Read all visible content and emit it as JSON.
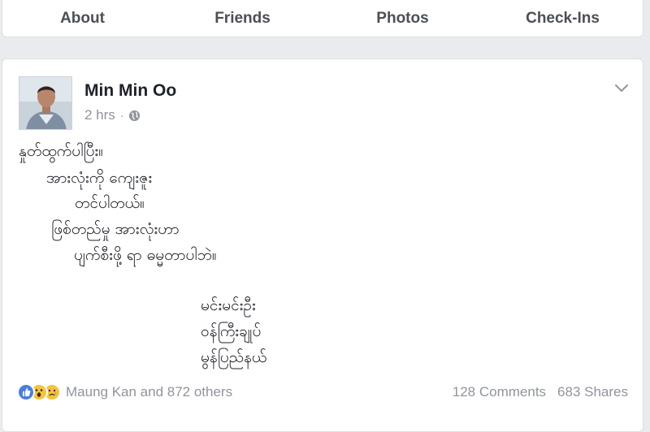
{
  "tabs": [
    {
      "label": "About"
    },
    {
      "label": "Friends"
    },
    {
      "label": "Photos"
    },
    {
      "label": "Check-Ins"
    }
  ],
  "post": {
    "author": "Min Min Oo",
    "time": "2 hrs",
    "separator": "·",
    "privacy_icon": "globe-icon",
    "menu_icon": "chevron-down-icon",
    "lines": [
      "နှုတ်ထွက်ပါပြီး။",
      "အားလုံးကို ကျေးဇူး",
      "တင်ပါတယ်။",
      "ဖြစ်တည်မှု အားလုံးဟာ",
      "ပျက်စီးဖို့ ရာ ဓမ္မတာပါဘဲ။",
      "မင်းမင်းဦး",
      "ဝန်ကြီးချုပ်",
      "မွန်ပြည်နယ်"
    ],
    "reactions": {
      "icons": [
        "like-icon",
        "wow-icon",
        "sad-icon"
      ],
      "text": "Maung Kan and 872 others"
    },
    "comments": "128 Comments",
    "shares": "683 Shares"
  },
  "colors": {
    "background": "#e9ebee",
    "card": "#ffffff",
    "text_primary": "#1d2129",
    "text_secondary": "#90949c",
    "tab_text": "#4b4f56",
    "like_blue": "#4a7fe0",
    "emoji_yellow": "#f5c33b"
  }
}
